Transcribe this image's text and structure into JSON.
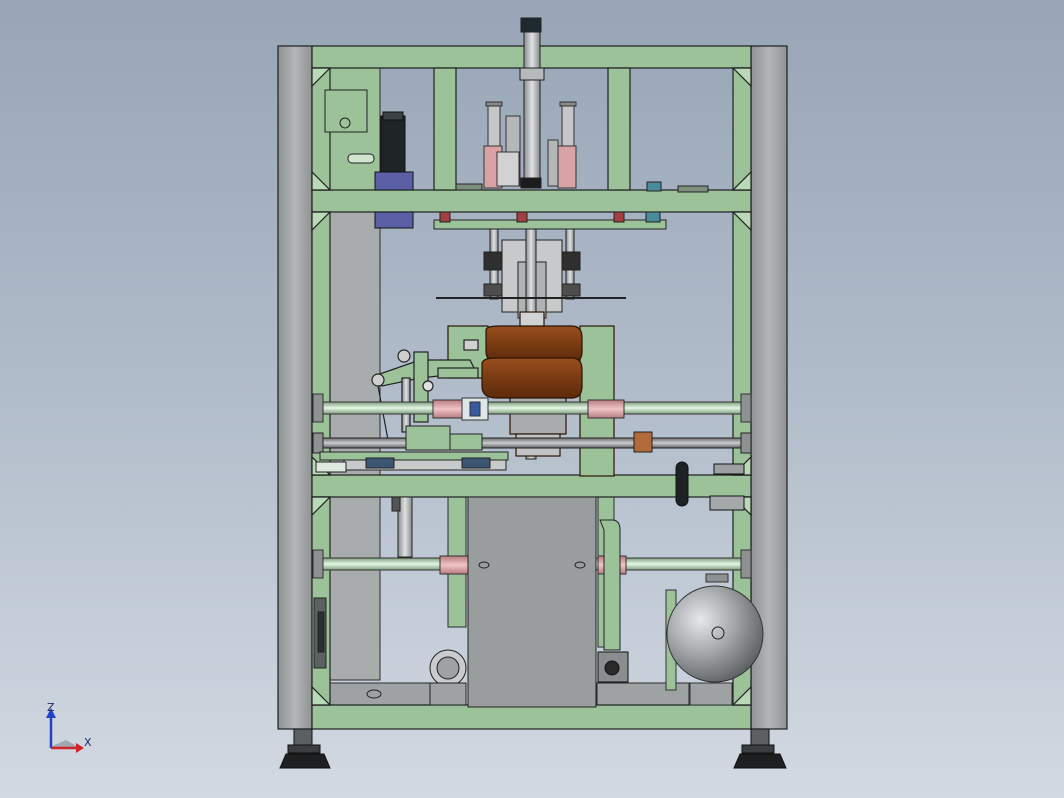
{
  "triad": {
    "z_label": "Z",
    "x_label": "X"
  },
  "colors": {
    "background_top": "#97a5b6",
    "background_bottom": "#d2d9e2",
    "frame_post": "#a7aaab",
    "frame_beam": "#9cc29a",
    "panel": "#8e9293",
    "rod": "#cfe7cf",
    "collar": "#d9a3a6",
    "motor": "#5b5fa6",
    "bowl": "#7a3c14",
    "tank": "#a3a6a8"
  }
}
